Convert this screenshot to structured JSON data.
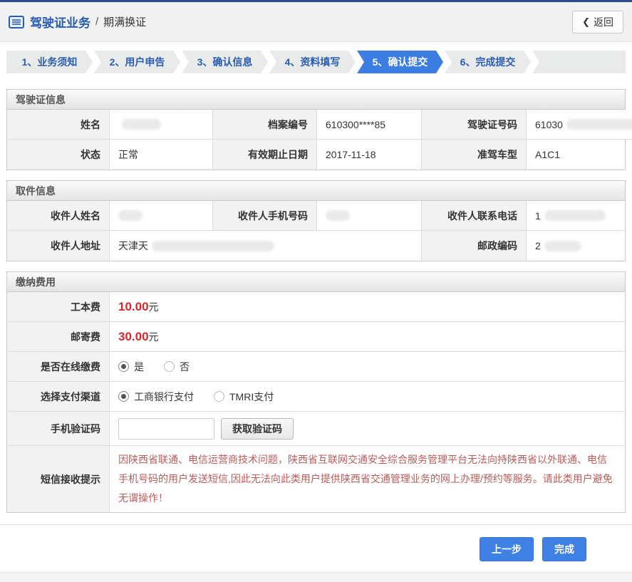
{
  "page": {
    "title": "驾驶证业务",
    "breadcrumb_separator": "/",
    "subtitle": "期满换证",
    "back_button": "返回",
    "back_chevron": "❮"
  },
  "steps": [
    {
      "label": "1、业务须知",
      "active": false
    },
    {
      "label": "2、用户申告",
      "active": false
    },
    {
      "label": "3、确认信息",
      "active": false
    },
    {
      "label": "4、资料填写",
      "active": false
    },
    {
      "label": "5、确认提交",
      "active": true
    },
    {
      "label": "6、完成提交",
      "active": false
    }
  ],
  "license_section": {
    "title": "驾驶证信息",
    "fields": [
      {
        "label": "姓名",
        "value": "",
        "redacted": true
      },
      {
        "label": "档案编号",
        "value": "610300****85",
        "redacted": false
      },
      {
        "label": "驾驶证号码",
        "value": "61030",
        "redacted": true
      },
      {
        "label": "状态",
        "value": "正常",
        "redacted": false
      },
      {
        "label": "有效期止日期",
        "value": "2017-11-18",
        "redacted": false
      },
      {
        "label": "准驾车型",
        "value": "A1C1",
        "redacted": false
      }
    ]
  },
  "pickup_section": {
    "title": "取件信息",
    "fields": [
      {
        "label": "收件人姓名",
        "value": "",
        "redacted": true
      },
      {
        "label": "收件人手机号码",
        "value": "",
        "redacted": true
      },
      {
        "label": "收件人联系电话",
        "value": "1",
        "redacted": true
      },
      {
        "label": "收件人地址",
        "value": "天津天",
        "redacted": true
      },
      {
        "label": "邮政编码",
        "value": "2",
        "redacted": true
      }
    ]
  },
  "fees_section": {
    "title": "缴纳费用",
    "production_fee": {
      "label": "工本费",
      "amount": "10.00",
      "unit": "元"
    },
    "mail_fee": {
      "label": "邮寄费",
      "amount": "30.00",
      "unit": "元"
    },
    "online_payment": {
      "label": "是否在线缴费",
      "options": [
        {
          "label": "是",
          "selected": true
        },
        {
          "label": "否",
          "selected": false
        }
      ]
    },
    "payment_channel": {
      "label": "选择支付渠道",
      "options": [
        {
          "label": "工商银行支付",
          "selected": true
        },
        {
          "label": "TMRI支付",
          "selected": false
        }
      ]
    },
    "sms_code": {
      "label": "手机验证码",
      "input_value": "",
      "button_label": "获取验证码"
    },
    "sms_notice": {
      "label": "短信接收提示",
      "text": "因陕西省联通、电信运营商技术问题，陕西省互联网交通安全综合服务管理平台无法向持陕西省以外联通、电信手机号码的用户发送短信,因此无法向此类用户提供陕西省交通管理业务的网上办理/预约等服务。请此类用户避免无谓操作！"
    }
  },
  "footer": {
    "prev_button": "上一步",
    "finish_button": "完成"
  },
  "colors": {
    "brand_blue": "#2b4d8f",
    "link_blue": "#2a5db0",
    "active_tab_blue": "#3b7de0",
    "button_blue": "#3e80e3",
    "fee_red": "#d8262c",
    "notice_red": "#b85c5c"
  }
}
